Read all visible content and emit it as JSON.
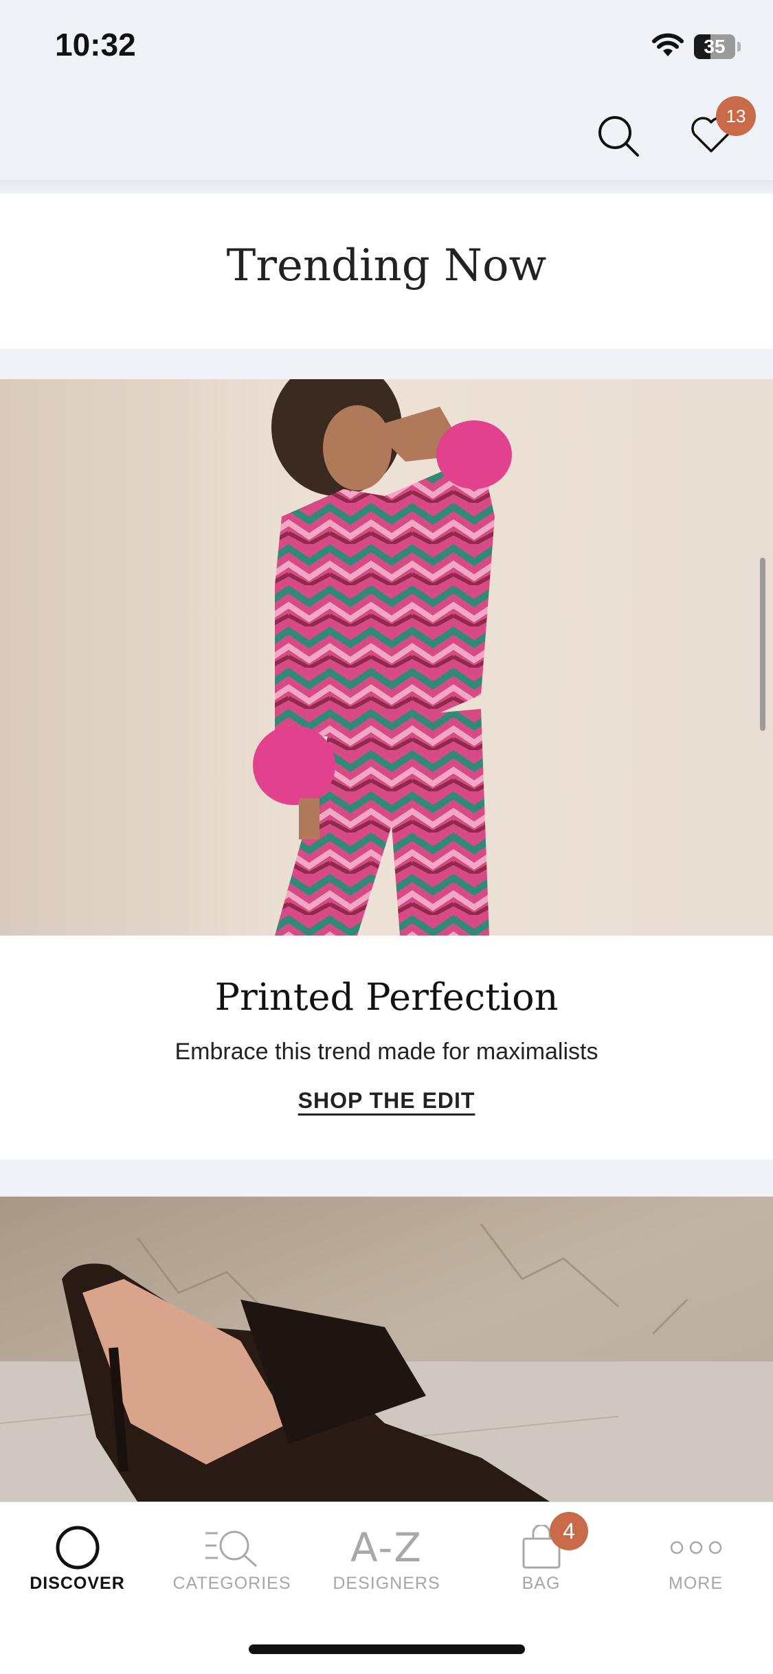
{
  "status": {
    "time": "10:32",
    "battery": "35"
  },
  "header": {
    "wishlist_count": "13"
  },
  "section": {
    "title": "Trending Now"
  },
  "promo": {
    "title": "Printed Perfection",
    "subtitle": "Embrace this trend made for maximalists",
    "cta": "SHOP THE EDIT"
  },
  "tabbar": {
    "tabs": [
      {
        "label": "DISCOVER",
        "icon": "circle-icon"
      },
      {
        "label": "CATEGORIES",
        "icon": "list-search-icon"
      },
      {
        "label": "DESIGNERS",
        "icon_text": "A-Z"
      },
      {
        "label": "BAG",
        "icon": "bag-icon",
        "badge": "4"
      },
      {
        "label": "MORE",
        "icon": "dots-icon"
      }
    ]
  },
  "colors": {
    "accent": "#c96a48",
    "background": "#eff2f6",
    "active_text": "#111111",
    "inactive_text": "#a6a6a6"
  }
}
